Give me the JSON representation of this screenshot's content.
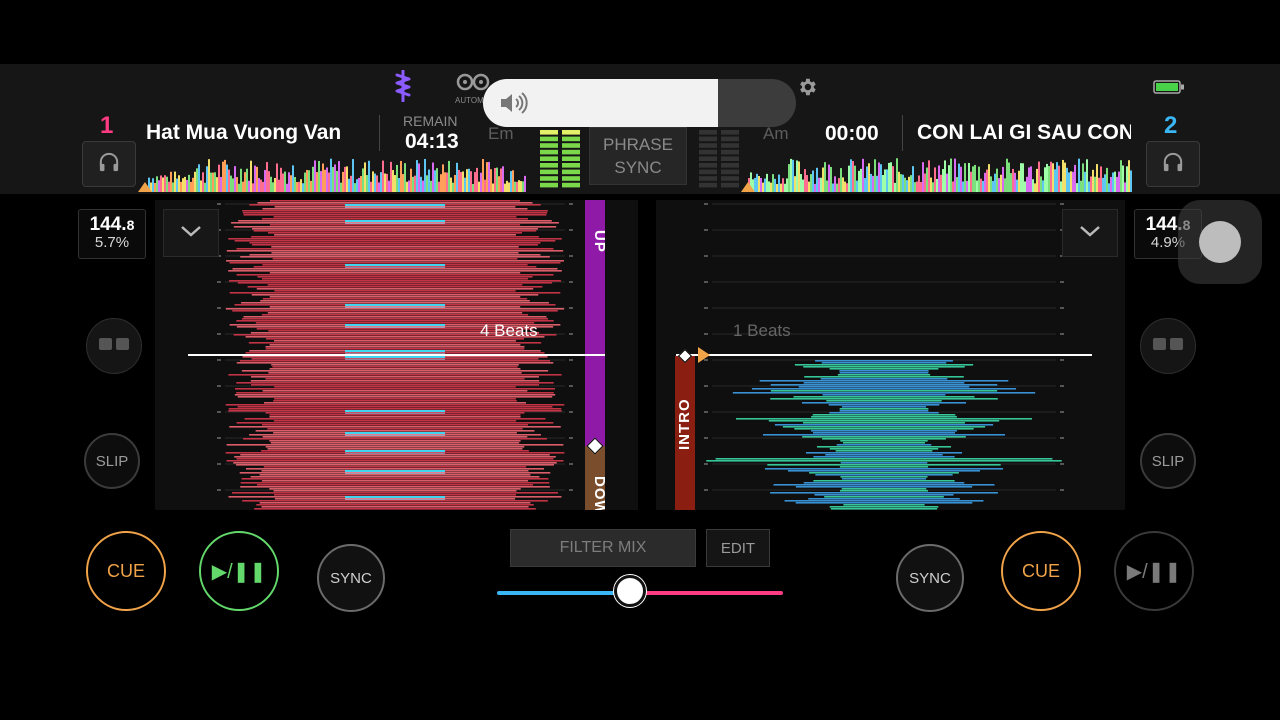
{
  "colors": {
    "deck1": "#ff3c83",
    "deck2": "#3bb6f5",
    "cue": "#f0a348",
    "play": "#63d86b",
    "crossfader_left": "#3bb6f5",
    "crossfader_right": "#ff3c83"
  },
  "header": {
    "icons": [
      "waveform-logo-icon",
      "automix-icon",
      "settings-icon",
      "battery-icon"
    ],
    "automix_label": "AUTOM"
  },
  "deck1": {
    "number": "1",
    "title": "Hat Mua Vuong Van",
    "remain_label": "REMAIN",
    "remain_time": "04:13",
    "key": "Em",
    "bpm_main": "144.",
    "bpm_decimal": "8",
    "pitch": "5.7%",
    "beats_label": "4 Beats",
    "phrase_upper": "UP",
    "phrase_lower": "DOWN",
    "slip_label": "SLIP",
    "cue_label": "CUE",
    "play_label": "▶/❚❚",
    "sync_label": "SYNC"
  },
  "deck2": {
    "number": "2",
    "title": "CON LAI GI SAU CON MUA",
    "elapsed_time": "00:00",
    "key": "Am",
    "bpm_main": "144.",
    "bpm_decimal": "8",
    "pitch": "4.9%",
    "beats_label": "1 Beats",
    "phrase_label": "INTRO",
    "slip_label": "SLIP",
    "cue_label": "CUE",
    "play_label": "▶/❚❚",
    "sync_label": "SYNC"
  },
  "mixer": {
    "phrase_sync_line1": "PHRASE",
    "phrase_sync_line2": "SYNC",
    "filter_mix_label": "FILTER MIX",
    "edit_label": "EDIT",
    "crossfader_position": 0.6
  },
  "system": {
    "volume_level": 0.75,
    "volume_icon": "speaker-icon"
  }
}
